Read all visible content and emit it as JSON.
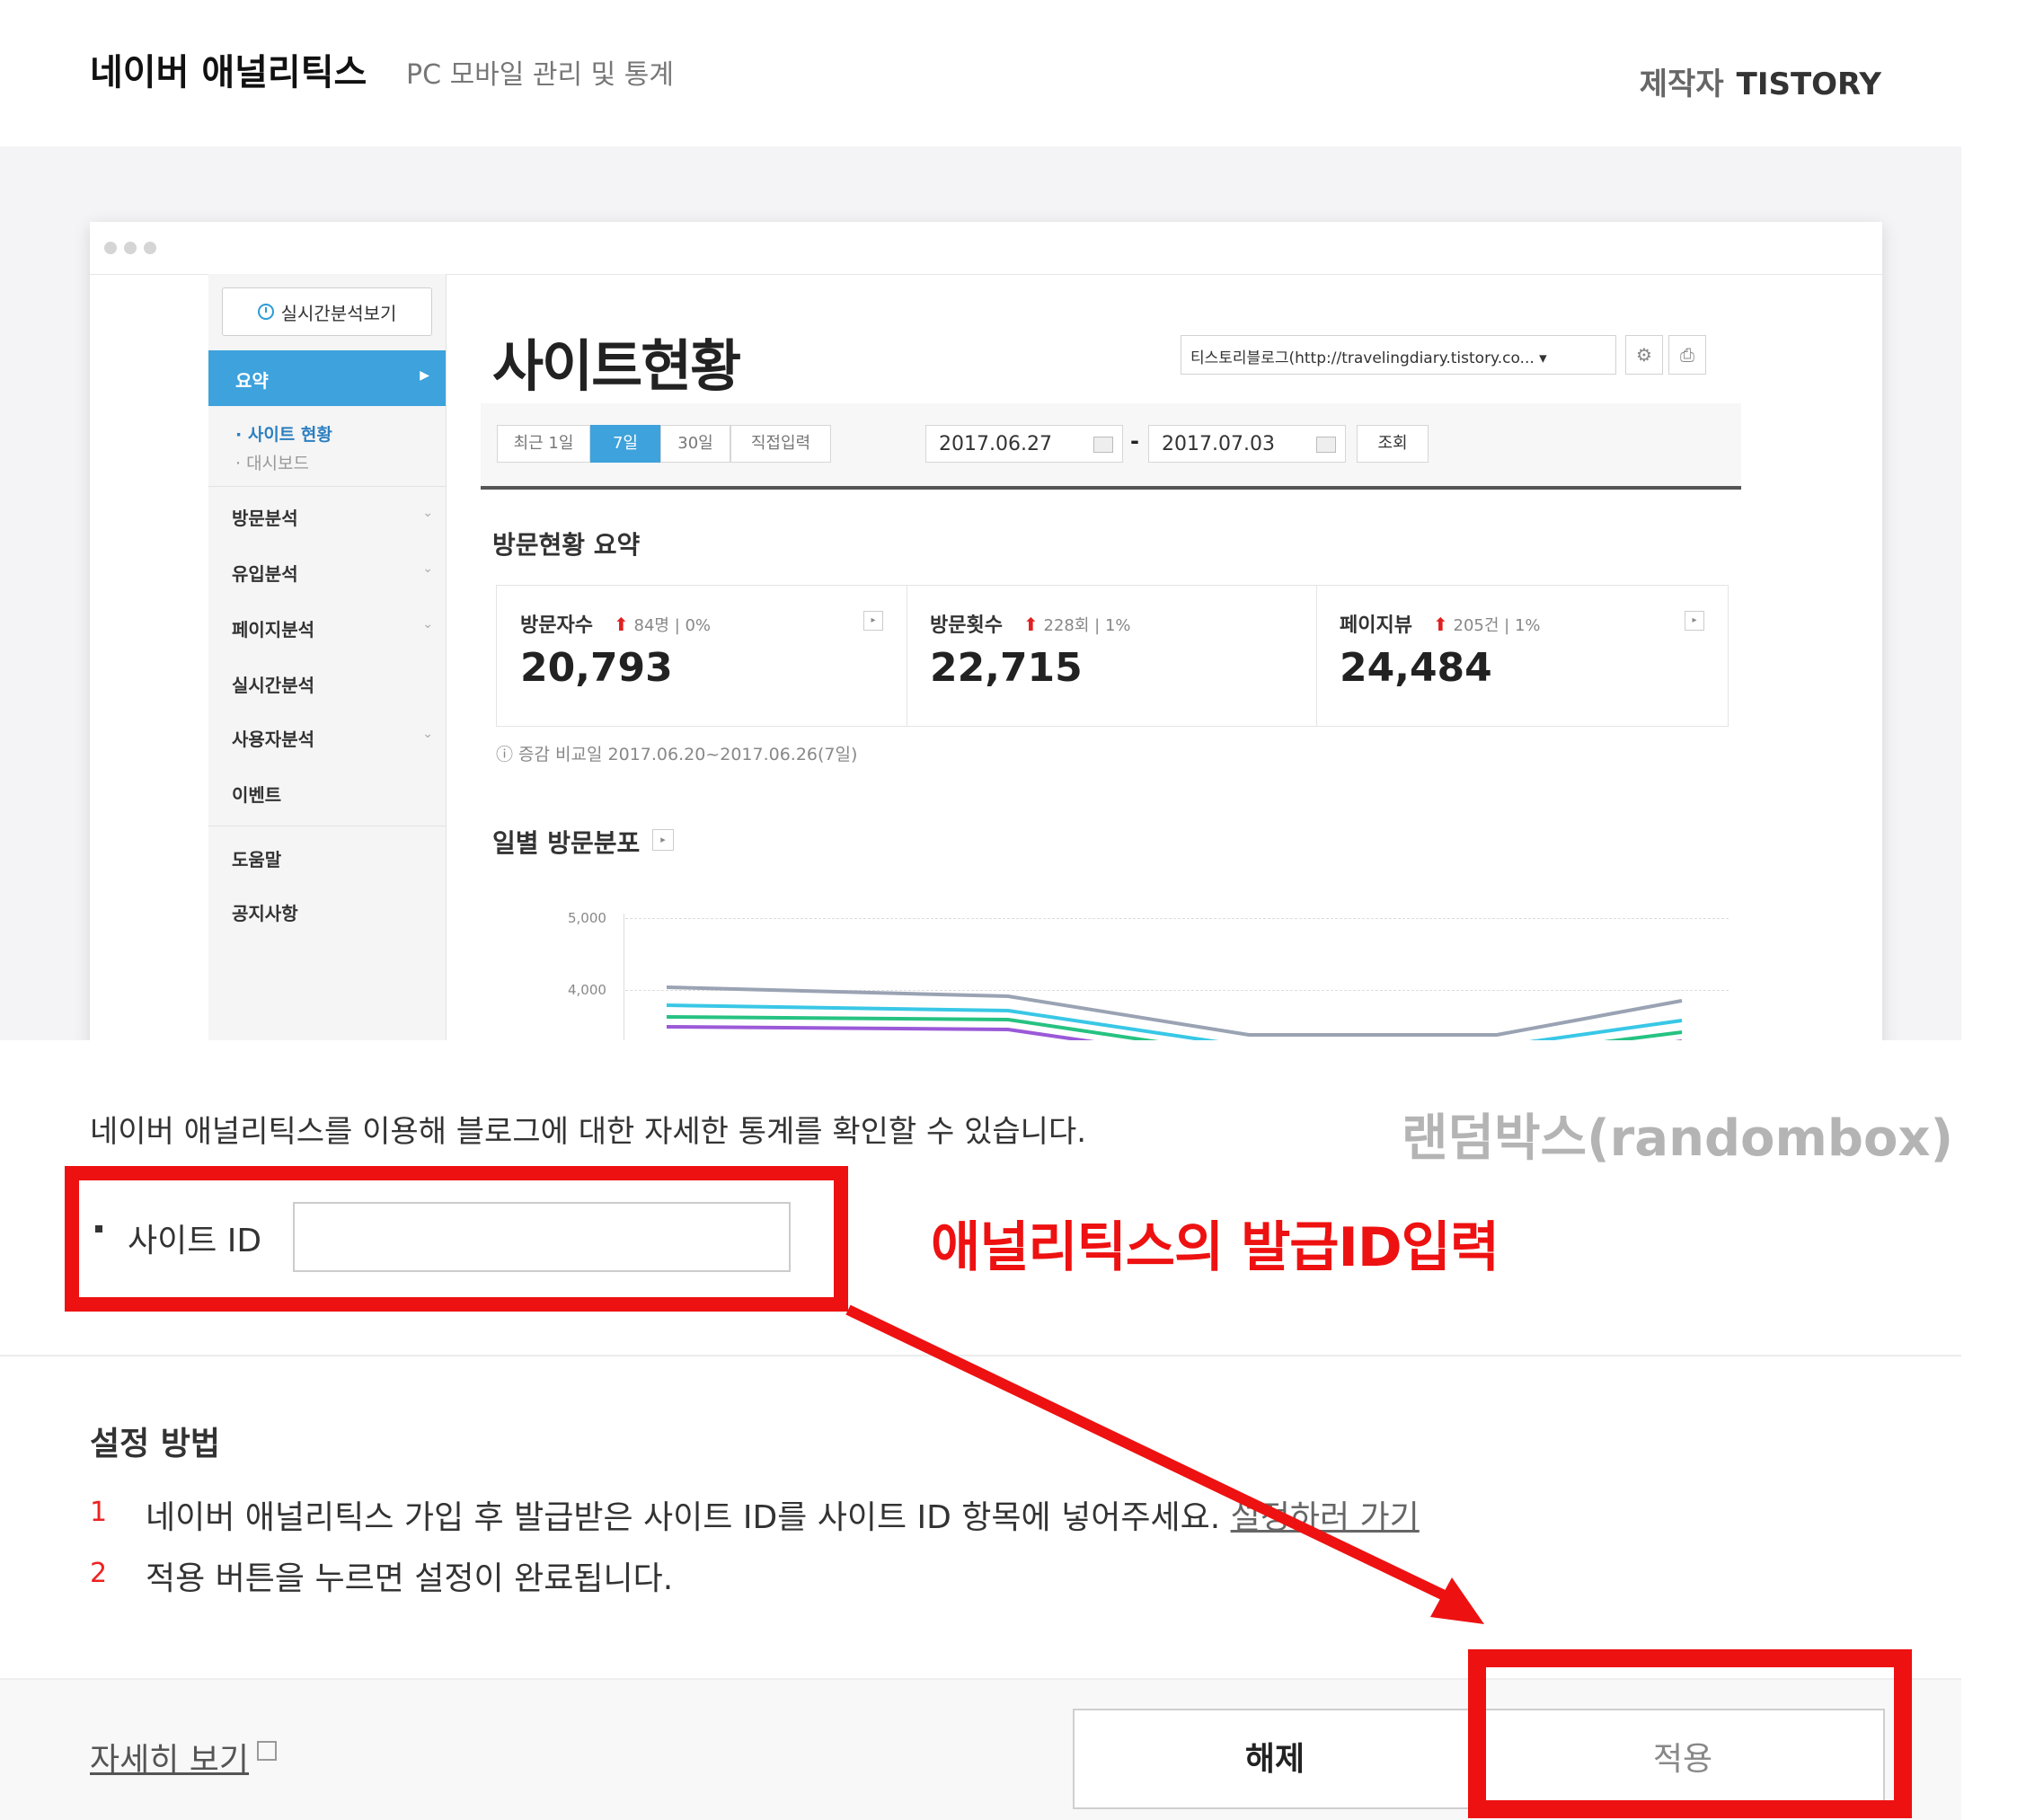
{
  "header": {
    "title": "네이버 애널리틱스",
    "subtitle": "PC 모바일 관리 및 통계",
    "maker_label": "제작자",
    "maker_name": "TISTORY"
  },
  "preview": {
    "realtime_button": "실시간분석보기",
    "sidebar": {
      "active": "요약",
      "sub_items": [
        "· 사이트 현황",
        "· 대시보드"
      ],
      "items": [
        "방문분석",
        "유입분석",
        "페이지분석",
        "실시간분석",
        "사용자분석",
        "이벤트",
        "도움말",
        "공지사항"
      ]
    },
    "page_title": "사이트현황",
    "site_select": "티스토리블로그(http://travelingdiary.tistory.co... ▾",
    "date_tabs": [
      "최근 1일",
      "7일",
      "30일",
      "직접입력"
    ],
    "active_tab": "7일",
    "date_from": "2017.06.27",
    "date_separator": "-",
    "date_to": "2017.07.03",
    "search_button": "조회",
    "summary_title": "방문현황 요약",
    "summary_cells": [
      {
        "label": "방문자수",
        "delta": "84명",
        "pct": "0%",
        "value": "20,793"
      },
      {
        "label": "방문횟수",
        "delta": "228회",
        "pct": "1%",
        "value": "22,715"
      },
      {
        "label": "페이지뷰",
        "delta": "205건",
        "pct": "1%",
        "value": "24,484"
      }
    ],
    "compare_note": "ⓘ 증감 비교일  2017.06.20~2017.06.26(7일)",
    "daily_title": "일별 방문분포",
    "chart_ylabels": [
      "5,000",
      "4,000"
    ]
  },
  "settings": {
    "description": "네이버 애널리틱스를 이용해 블로그에 대한 자세한 통계를 확인할 수 있습니다.",
    "watermark": "랜덤박스(randombox)",
    "site_id_label": "사이트 ID",
    "site_id_value": "",
    "annotation": "애널리틱스의 발급ID입력",
    "how_title": "설정 방법",
    "steps": [
      {
        "num": "1",
        "text": "네이버 애널리틱스 가입 후 발급받은 사이트 ID를 사이트 ID 항목에 넣어주세요.",
        "link": "설정하러 가기"
      },
      {
        "num": "2",
        "text": "적용 버튼을 누르면 설정이 완료됩니다."
      }
    ],
    "more_link": "자세히 보기",
    "release_button": "해제",
    "apply_button": "적용"
  },
  "colors": {
    "accent_blue": "#3ea2dc",
    "annotation_red": "#ee1111",
    "chart_lines": [
      "#9aa3b3",
      "#39c7e6",
      "#26c281",
      "#9b59d8"
    ]
  }
}
